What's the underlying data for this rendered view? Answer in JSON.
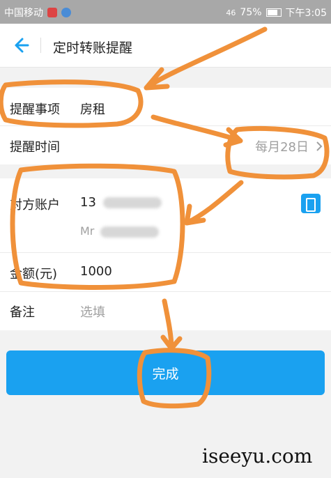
{
  "status_bar": {
    "carrier": "中国移动",
    "signal_label": "46",
    "battery": "75%",
    "time": "下午3:05"
  },
  "header": {
    "back_icon": "arrow-left-icon",
    "title": "定时转账提醒"
  },
  "form": {
    "reminder_item": {
      "label": "提醒事项",
      "value": "房租"
    },
    "reminder_time": {
      "label": "提醒时间",
      "value": "每月28日"
    },
    "payee_account": {
      "label": "对方账户",
      "value": "13",
      "name_prefix": "Mr"
    },
    "amount": {
      "label": "金额(元)",
      "value": "1000"
    },
    "note": {
      "label": "备注",
      "placeholder": "选填"
    }
  },
  "actions": {
    "done_label": "完成"
  },
  "watermark": "iseeyu.com",
  "colors": {
    "accent": "#1aa1f0",
    "annotation": "#f0913a",
    "status_bar": "#a8a8a8"
  }
}
